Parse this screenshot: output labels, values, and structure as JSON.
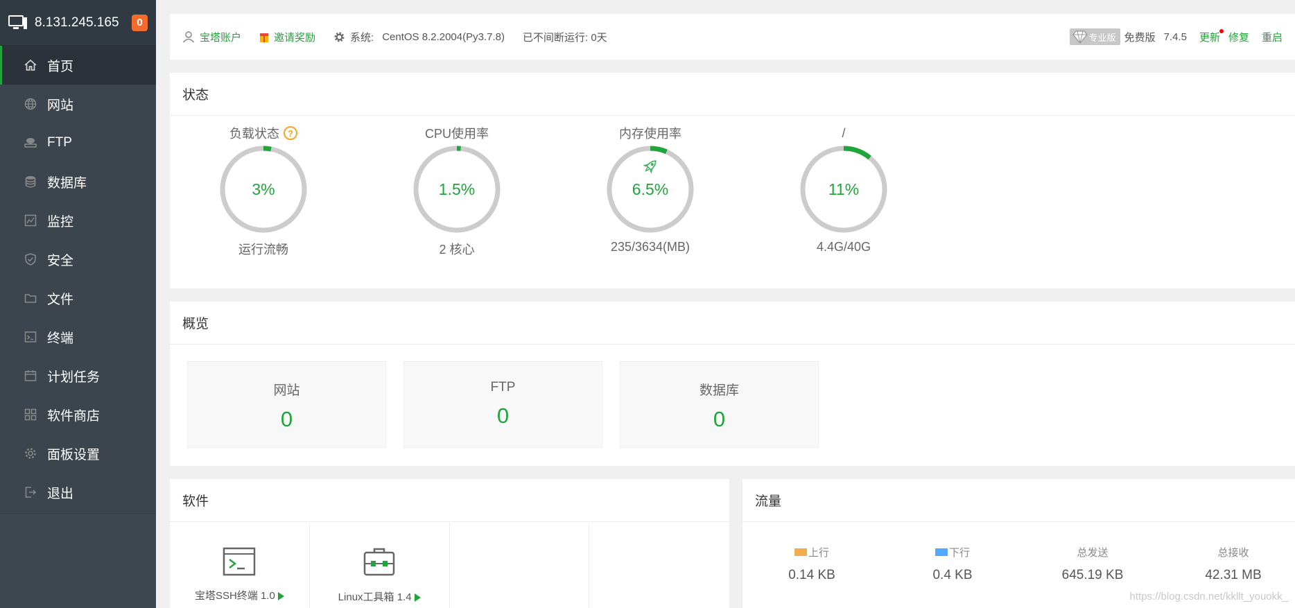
{
  "sidebar": {
    "host_ip": "8.131.245.165",
    "notice_count": "0",
    "items": [
      {
        "label": "首页",
        "icon": "home-icon"
      },
      {
        "label": "网站",
        "icon": "globe-icon"
      },
      {
        "label": "FTP",
        "icon": "ftp-icon"
      },
      {
        "label": "数据库",
        "icon": "database-icon"
      },
      {
        "label": "监控",
        "icon": "monitor-icon"
      },
      {
        "label": "安全",
        "icon": "shield-icon"
      },
      {
        "label": "文件",
        "icon": "folder-icon"
      },
      {
        "label": "终端",
        "icon": "terminal-icon"
      },
      {
        "label": "计划任务",
        "icon": "calendar-icon"
      },
      {
        "label": "软件商店",
        "icon": "grid-icon"
      },
      {
        "label": "面板设置",
        "icon": "gear-icon"
      },
      {
        "label": "退出",
        "icon": "logout-icon"
      }
    ]
  },
  "topbar": {
    "account": "宝塔账户",
    "invite": "邀请奖励",
    "system_label": "系统:",
    "system_value": "CentOS 8.2.2004(Py3.7.8)",
    "uptime": "已不间断运行: 0天",
    "pro_label": "专业版",
    "edition": "免费版",
    "version": "7.4.5",
    "update": "更新",
    "repair": "修复",
    "restart": "重启"
  },
  "status": {
    "title": "状态",
    "gauges": [
      {
        "label": "负载状态",
        "value": "3%",
        "sub": "运行流畅",
        "percent": 3,
        "help": "?"
      },
      {
        "label": "CPU使用率",
        "value": "1.5%",
        "sub": "2 核心",
        "percent": 1.5
      },
      {
        "label": "内存使用率",
        "value": "6.5%",
        "sub": "235/3634(MB)",
        "percent": 6.5
      },
      {
        "label": "/",
        "value": "11%",
        "sub": "4.4G/40G",
        "percent": 11
      }
    ]
  },
  "overview": {
    "title": "概览",
    "cards": [
      {
        "label": "网站",
        "value": "0"
      },
      {
        "label": "FTP",
        "value": "0"
      },
      {
        "label": "数据库",
        "value": "0"
      }
    ]
  },
  "software": {
    "title": "软件",
    "items": [
      {
        "name": "宝塔SSH终端 1.0",
        "icon": "ssh-terminal-icon"
      },
      {
        "name": "Linux工具箱 1.4",
        "icon": "toolbox-icon"
      }
    ]
  },
  "traffic": {
    "title": "流量",
    "columns": [
      {
        "label": "上行",
        "value": "0.14 KB",
        "color": "#f0ad4e"
      },
      {
        "label": "下行",
        "value": "0.4 KB",
        "color": "#52a9ff"
      },
      {
        "label": "总发送",
        "value": "645.19 KB"
      },
      {
        "label": "总接收",
        "value": "42.31 MB"
      }
    ]
  },
  "watermark": "https://blog.csdn.net/kkllt_youokk_",
  "colors": {
    "accent": "#20a53a",
    "sidebar": "#3c444d",
    "badge": "#f46b2d"
  }
}
